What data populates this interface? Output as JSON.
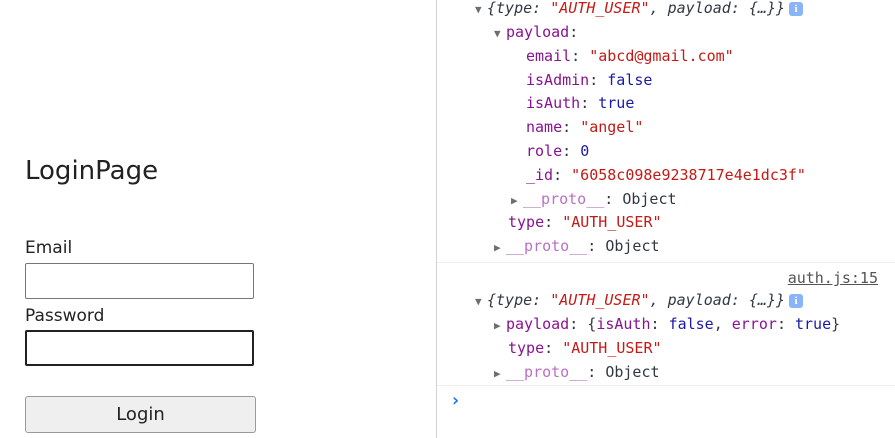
{
  "login": {
    "title": "LoginPage",
    "email_label": "Email",
    "password_label": "Password",
    "email_value": "",
    "password_value": "",
    "button_label": "Login"
  },
  "console": {
    "entry1": {
      "summary_prefix": "{type: ",
      "summary_type": "\"AUTH_USER\"",
      "summary_mid": ", payload: ",
      "summary_end": "{…}}",
      "payload_key": "payload",
      "email_key": "email",
      "email_value": "\"abcd@gmail.com\"",
      "isAdmin_key": "isAdmin",
      "isAdmin_value": "false",
      "isAuth_key": "isAuth",
      "isAuth_value": "true",
      "name_key": "name",
      "name_value": "\"angel\"",
      "role_key": "role",
      "role_value": "0",
      "id_key": "_id",
      "id_value": "\"6058c098e9238717e4e1dc3f\"",
      "proto_key": "__proto__",
      "proto_value": "Object",
      "type_key": "type",
      "type_value": "\"AUTH_USER\"",
      "outer_proto_key": "__proto__",
      "outer_proto_value": "Object"
    },
    "entry2": {
      "source_link": "auth.js:15",
      "summary_prefix": "{type: ",
      "summary_type": "\"AUTH_USER\"",
      "summary_mid": ", payload: ",
      "summary_end": "{…}}",
      "payload_key": "payload",
      "payload_open": "{",
      "isAuth_key": "isAuth",
      "isAuth_value": "false",
      "error_key": "error",
      "error_value": "true",
      "payload_close": "}",
      "type_key": "type",
      "type_value": "\"AUTH_USER\"",
      "proto_key": "__proto__",
      "proto_value": "Object"
    },
    "prompt_symbol": "›",
    "info_glyph": "i"
  }
}
